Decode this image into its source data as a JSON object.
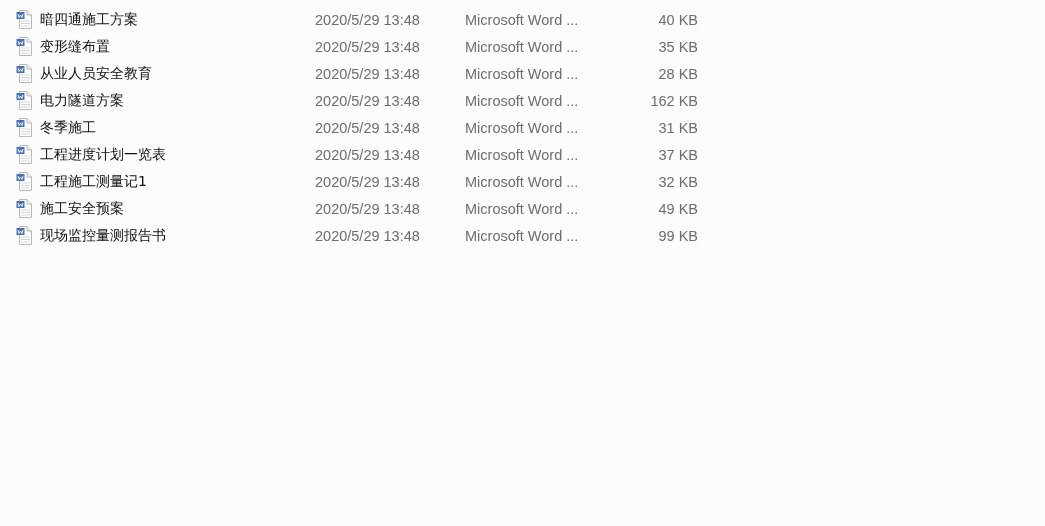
{
  "files": [
    {
      "name": "暗四通施工方案",
      "modified": "2020/5/29 13:48",
      "type": "Microsoft Word ...",
      "size": "40 KB"
    },
    {
      "name": "变形缝布置",
      "modified": "2020/5/29 13:48",
      "type": "Microsoft Word ...",
      "size": "35 KB"
    },
    {
      "name": "从业人员安全教育",
      "modified": "2020/5/29 13:48",
      "type": "Microsoft Word ...",
      "size": "28 KB"
    },
    {
      "name": "电力隧道方案",
      "modified": "2020/5/29 13:48",
      "type": "Microsoft Word ...",
      "size": "162 KB"
    },
    {
      "name": "冬季施工",
      "modified": "2020/5/29 13:48",
      "type": "Microsoft Word ...",
      "size": "31 KB"
    },
    {
      "name": "工程进度计划一览表",
      "modified": "2020/5/29 13:48",
      "type": "Microsoft Word ...",
      "size": "37 KB"
    },
    {
      "name": "工程施工测量记1",
      "modified": "2020/5/29 13:48",
      "type": "Microsoft Word ...",
      "size": "32 KB"
    },
    {
      "name": "施工安全预案",
      "modified": "2020/5/29 13:48",
      "type": "Microsoft Word ...",
      "size": "49 KB"
    },
    {
      "name": "现场监控量测报告书",
      "modified": "2020/5/29 13:48",
      "type": "Microsoft Word ...",
      "size": "99 KB"
    }
  ]
}
